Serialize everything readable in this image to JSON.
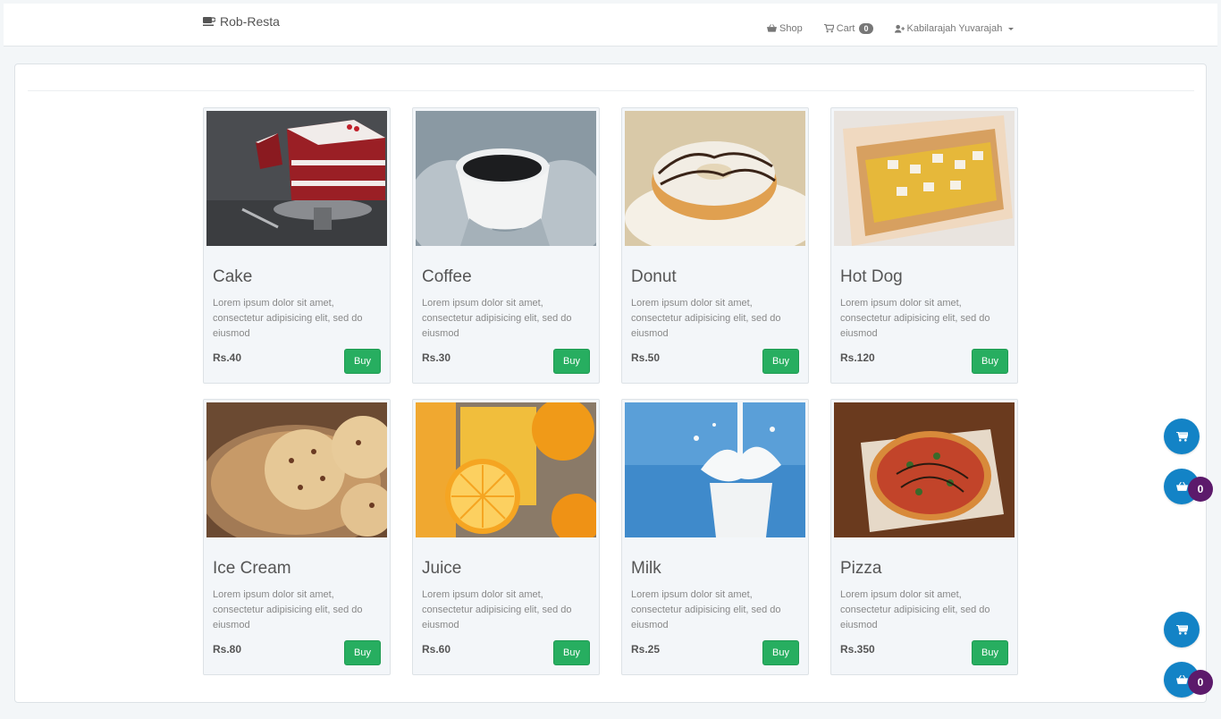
{
  "brand": {
    "name": "Rob-Resta",
    "icon": "coffee-icon"
  },
  "nav": {
    "shop_label": "Shop",
    "cart_label": "Cart",
    "cart_count": "0",
    "user_name": "Kabilarajah Yuvarajah"
  },
  "products": [
    {
      "name": "Cake",
      "desc": "Lorem ipsum dolor sit amet, consectetur adipisicing elit, sed do eiusmod",
      "price": "Rs.40",
      "buy_label": "Buy"
    },
    {
      "name": "Coffee",
      "desc": "Lorem ipsum dolor sit amet, consectetur adipisicing elit, sed do eiusmod",
      "price": "Rs.30",
      "buy_label": "Buy"
    },
    {
      "name": "Donut",
      "desc": "Lorem ipsum dolor sit amet, consectetur adipisicing elit, sed do eiusmod",
      "price": "Rs.50",
      "buy_label": "Buy"
    },
    {
      "name": "Hot Dog",
      "desc": "Lorem ipsum dolor sit amet, consectetur adipisicing elit, sed do eiusmod",
      "price": "Rs.120",
      "buy_label": "Buy"
    },
    {
      "name": "Ice Cream",
      "desc": "Lorem ipsum dolor sit amet, consectetur adipisicing elit, sed do eiusmod",
      "price": "Rs.80",
      "buy_label": "Buy"
    },
    {
      "name": "Juice",
      "desc": "Lorem ipsum dolor sit amet, consectetur adipisicing elit, sed do eiusmod",
      "price": "Rs.60",
      "buy_label": "Buy"
    },
    {
      "name": "Milk",
      "desc": "Lorem ipsum dolor sit amet, consectetur adipisicing elit, sed do eiusmod",
      "price": "Rs.25",
      "buy_label": "Buy"
    },
    {
      "name": "Pizza",
      "desc": "Lorem ipsum dolor sit amet, consectetur adipisicing elit, sed do eiusmod",
      "price": "Rs.350",
      "buy_label": "Buy"
    }
  ],
  "floating": {
    "basket_count_1": "0",
    "basket_count_2": "0"
  },
  "colors": {
    "buy_button": "#27ae60",
    "fab": "#1383c6",
    "fab_badge": "#5c1a6b",
    "page_bg": "#f3f6f8"
  }
}
